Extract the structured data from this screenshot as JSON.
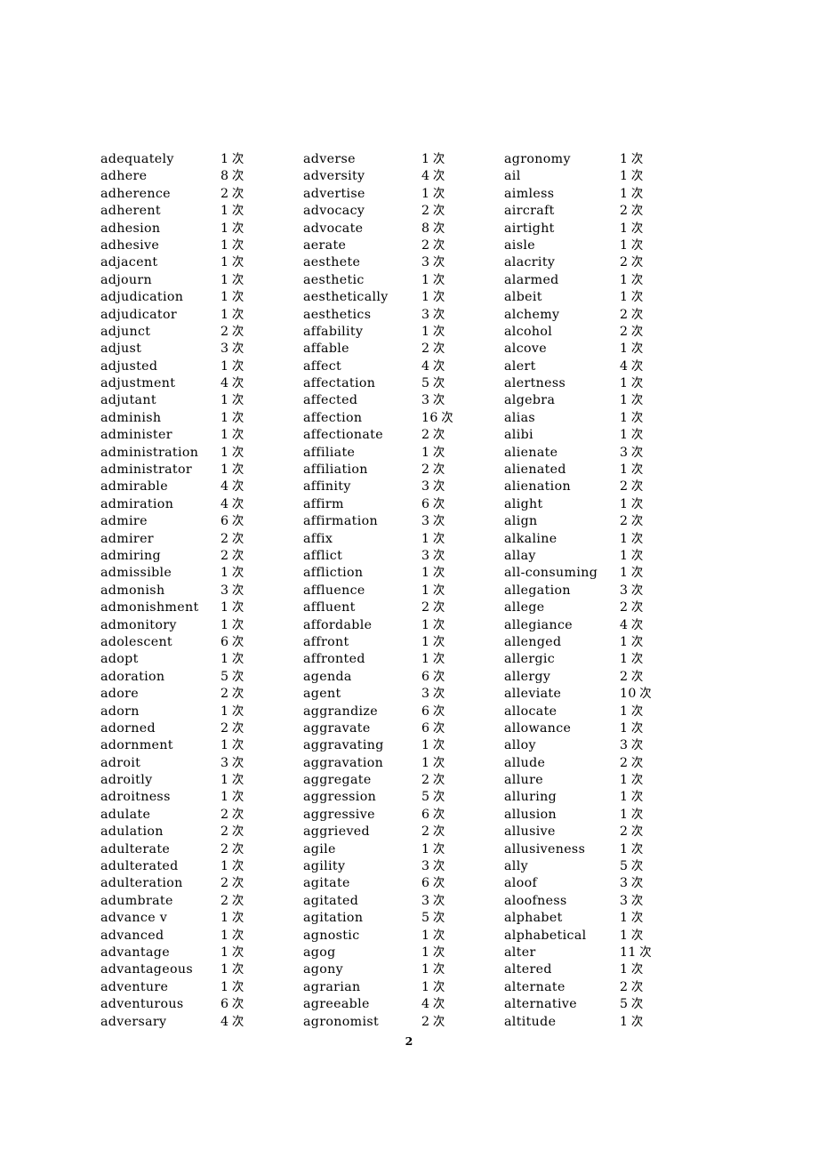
{
  "document": {
    "page_number": "2",
    "count_unit": "次",
    "columns": [
      {
        "entries": [
          {
            "word": "adequately",
            "count": "1"
          },
          {
            "word": "adhere",
            "count": "8"
          },
          {
            "word": "adherence",
            "count": "2"
          },
          {
            "word": "adherent",
            "count": "1"
          },
          {
            "word": "adhesion",
            "count": "1"
          },
          {
            "word": "adhesive",
            "count": "1"
          },
          {
            "word": "adjacent",
            "count": "1"
          },
          {
            "word": "adjourn",
            "count": "1"
          },
          {
            "word": "adjudication",
            "count": "1"
          },
          {
            "word": "adjudicator",
            "count": "1"
          },
          {
            "word": "adjunct",
            "count": "2"
          },
          {
            "word": "adjust",
            "count": "3"
          },
          {
            "word": "adjusted",
            "count": "1"
          },
          {
            "word": "adjustment",
            "count": "4"
          },
          {
            "word": "adjutant",
            "count": "1"
          },
          {
            "word": "adminish",
            "count": "1"
          },
          {
            "word": "administer",
            "count": "1"
          },
          {
            "word": "administration",
            "count": "1"
          },
          {
            "word": "administrator",
            "count": "1"
          },
          {
            "word": "admirable",
            "count": "4"
          },
          {
            "word": "admiration",
            "count": "4"
          },
          {
            "word": "admire",
            "count": "6"
          },
          {
            "word": "admirer",
            "count": "2"
          },
          {
            "word": "admiring",
            "count": "2"
          },
          {
            "word": "admissible",
            "count": "1"
          },
          {
            "word": "admonish",
            "count": "3"
          },
          {
            "word": "admonishment",
            "count": "1"
          },
          {
            "word": "admonitory",
            "count": "1"
          },
          {
            "word": "adolescent",
            "count": "6"
          },
          {
            "word": "adopt",
            "count": "1"
          },
          {
            "word": "adoration",
            "count": "5"
          },
          {
            "word": "adore",
            "count": "2"
          },
          {
            "word": "adorn",
            "count": "1"
          },
          {
            "word": "adorned",
            "count": "2"
          },
          {
            "word": "adornment",
            "count": "1"
          },
          {
            "word": "adroit",
            "count": "3"
          },
          {
            "word": "adroitly",
            "count": "1"
          },
          {
            "word": "adroitness",
            "count": "1"
          },
          {
            "word": "adulate",
            "count": "2"
          },
          {
            "word": "adulation",
            "count": "2"
          },
          {
            "word": "adulterate",
            "count": "2"
          },
          {
            "word": "adulterated",
            "count": "1"
          },
          {
            "word": "adulteration",
            "count": "2"
          },
          {
            "word": "adumbrate",
            "count": "2"
          },
          {
            "word": "advance v",
            "count": "1"
          },
          {
            "word": "advanced",
            "count": "1"
          },
          {
            "word": "advantage",
            "count": "1"
          },
          {
            "word": "advantageous",
            "count": "1"
          },
          {
            "word": "adventure",
            "count": "1"
          },
          {
            "word": "adventurous",
            "count": "6"
          },
          {
            "word": "adversary",
            "count": "4"
          }
        ]
      },
      {
        "entries": [
          {
            "word": "adverse",
            "count": "1"
          },
          {
            "word": "adversity",
            "count": "4"
          },
          {
            "word": "advertise",
            "count": "1"
          },
          {
            "word": "advocacy",
            "count": "2"
          },
          {
            "word": "advocate",
            "count": "8"
          },
          {
            "word": "aerate",
            "count": "2"
          },
          {
            "word": "aesthete",
            "count": "3"
          },
          {
            "word": "aesthetic",
            "count": "1"
          },
          {
            "word": "aesthetically",
            "count": "1"
          },
          {
            "word": "aesthetics",
            "count": "3"
          },
          {
            "word": "affability",
            "count": "1"
          },
          {
            "word": "affable",
            "count": "2"
          },
          {
            "word": "affect",
            "count": "4"
          },
          {
            "word": "affectation",
            "count": "5"
          },
          {
            "word": "affected",
            "count": "3"
          },
          {
            "word": "affection",
            "count": "16"
          },
          {
            "word": "affectionate",
            "count": "2"
          },
          {
            "word": "affiliate",
            "count": "1"
          },
          {
            "word": "affiliation",
            "count": "2"
          },
          {
            "word": "affinity",
            "count": "3"
          },
          {
            "word": "affirm",
            "count": "6"
          },
          {
            "word": "affirmation",
            "count": "3"
          },
          {
            "word": "affix",
            "count": "1"
          },
          {
            "word": "afflict",
            "count": "3"
          },
          {
            "word": "affliction",
            "count": "1"
          },
          {
            "word": "affluence",
            "count": "1"
          },
          {
            "word": "affluent",
            "count": "2"
          },
          {
            "word": "affordable",
            "count": "1"
          },
          {
            "word": "affront",
            "count": "1"
          },
          {
            "word": "affronted",
            "count": "1"
          },
          {
            "word": "agenda",
            "count": "6"
          },
          {
            "word": "agent",
            "count": "3"
          },
          {
            "word": "aggrandize",
            "count": "6"
          },
          {
            "word": "aggravate",
            "count": "6"
          },
          {
            "word": "aggravating",
            "count": "1"
          },
          {
            "word": "aggravation",
            "count": "1"
          },
          {
            "word": "aggregate",
            "count": "2"
          },
          {
            "word": "aggression",
            "count": "5"
          },
          {
            "word": "aggressive",
            "count": "6"
          },
          {
            "word": "aggrieved",
            "count": "2"
          },
          {
            "word": "agile",
            "count": "1"
          },
          {
            "word": "agility",
            "count": "3"
          },
          {
            "word": "agitate",
            "count": "6"
          },
          {
            "word": "agitated",
            "count": "3"
          },
          {
            "word": "agitation",
            "count": "5"
          },
          {
            "word": "agnostic",
            "count": "1"
          },
          {
            "word": "agog",
            "count": "1"
          },
          {
            "word": "agony",
            "count": "1"
          },
          {
            "word": "agrarian",
            "count": "1"
          },
          {
            "word": "agreeable",
            "count": "4"
          },
          {
            "word": "agronomist",
            "count": "2"
          }
        ]
      },
      {
        "entries": [
          {
            "word": "agronomy",
            "count": "1"
          },
          {
            "word": "ail",
            "count": "1"
          },
          {
            "word": "aimless",
            "count": "1"
          },
          {
            "word": "aircraft",
            "count": "2"
          },
          {
            "word": "airtight",
            "count": "1"
          },
          {
            "word": "aisle",
            "count": "1"
          },
          {
            "word": "alacrity",
            "count": "2"
          },
          {
            "word": "alarmed",
            "count": "1"
          },
          {
            "word": "albeit",
            "count": "1"
          },
          {
            "word": "alchemy",
            "count": "2"
          },
          {
            "word": "alcohol",
            "count": "2"
          },
          {
            "word": "alcove",
            "count": "1"
          },
          {
            "word": "alert",
            "count": "4"
          },
          {
            "word": "alertness",
            "count": "1"
          },
          {
            "word": "algebra",
            "count": "1"
          },
          {
            "word": "alias",
            "count": "1"
          },
          {
            "word": "alibi",
            "count": "1"
          },
          {
            "word": "alienate",
            "count": "3"
          },
          {
            "word": "alienated",
            "count": "1"
          },
          {
            "word": "alienation",
            "count": "2"
          },
          {
            "word": "alight",
            "count": "1"
          },
          {
            "word": "align",
            "count": "2"
          },
          {
            "word": "alkaline",
            "count": "1"
          },
          {
            "word": "allay",
            "count": "1"
          },
          {
            "word": "all-consuming",
            "count": "1"
          },
          {
            "word": "allegation",
            "count": "3"
          },
          {
            "word": "allege",
            "count": "2"
          },
          {
            "word": "allegiance",
            "count": "4"
          },
          {
            "word": "allenged",
            "count": "1"
          },
          {
            "word": "allergic",
            "count": "1"
          },
          {
            "word": "allergy",
            "count": "2"
          },
          {
            "word": "alleviate",
            "count": "10"
          },
          {
            "word": "allocate",
            "count": "1"
          },
          {
            "word": "allowance",
            "count": "1"
          },
          {
            "word": "alloy",
            "count": "3"
          },
          {
            "word": "allude",
            "count": "2"
          },
          {
            "word": "allure",
            "count": "1"
          },
          {
            "word": "alluring",
            "count": "1"
          },
          {
            "word": "allusion",
            "count": "1"
          },
          {
            "word": "allusive",
            "count": "2"
          },
          {
            "word": "allusiveness",
            "count": "1"
          },
          {
            "word": "ally",
            "count": "5"
          },
          {
            "word": "aloof",
            "count": "3"
          },
          {
            "word": "aloofness",
            "count": "3"
          },
          {
            "word": "alphabet",
            "count": "1"
          },
          {
            "word": "alphabetical",
            "count": "1"
          },
          {
            "word": "alter",
            "count": "11"
          },
          {
            "word": "altered",
            "count": "1"
          },
          {
            "word": "alternate",
            "count": "2"
          },
          {
            "word": "alternative",
            "count": "5"
          },
          {
            "word": "altitude",
            "count": "1"
          }
        ]
      }
    ]
  }
}
